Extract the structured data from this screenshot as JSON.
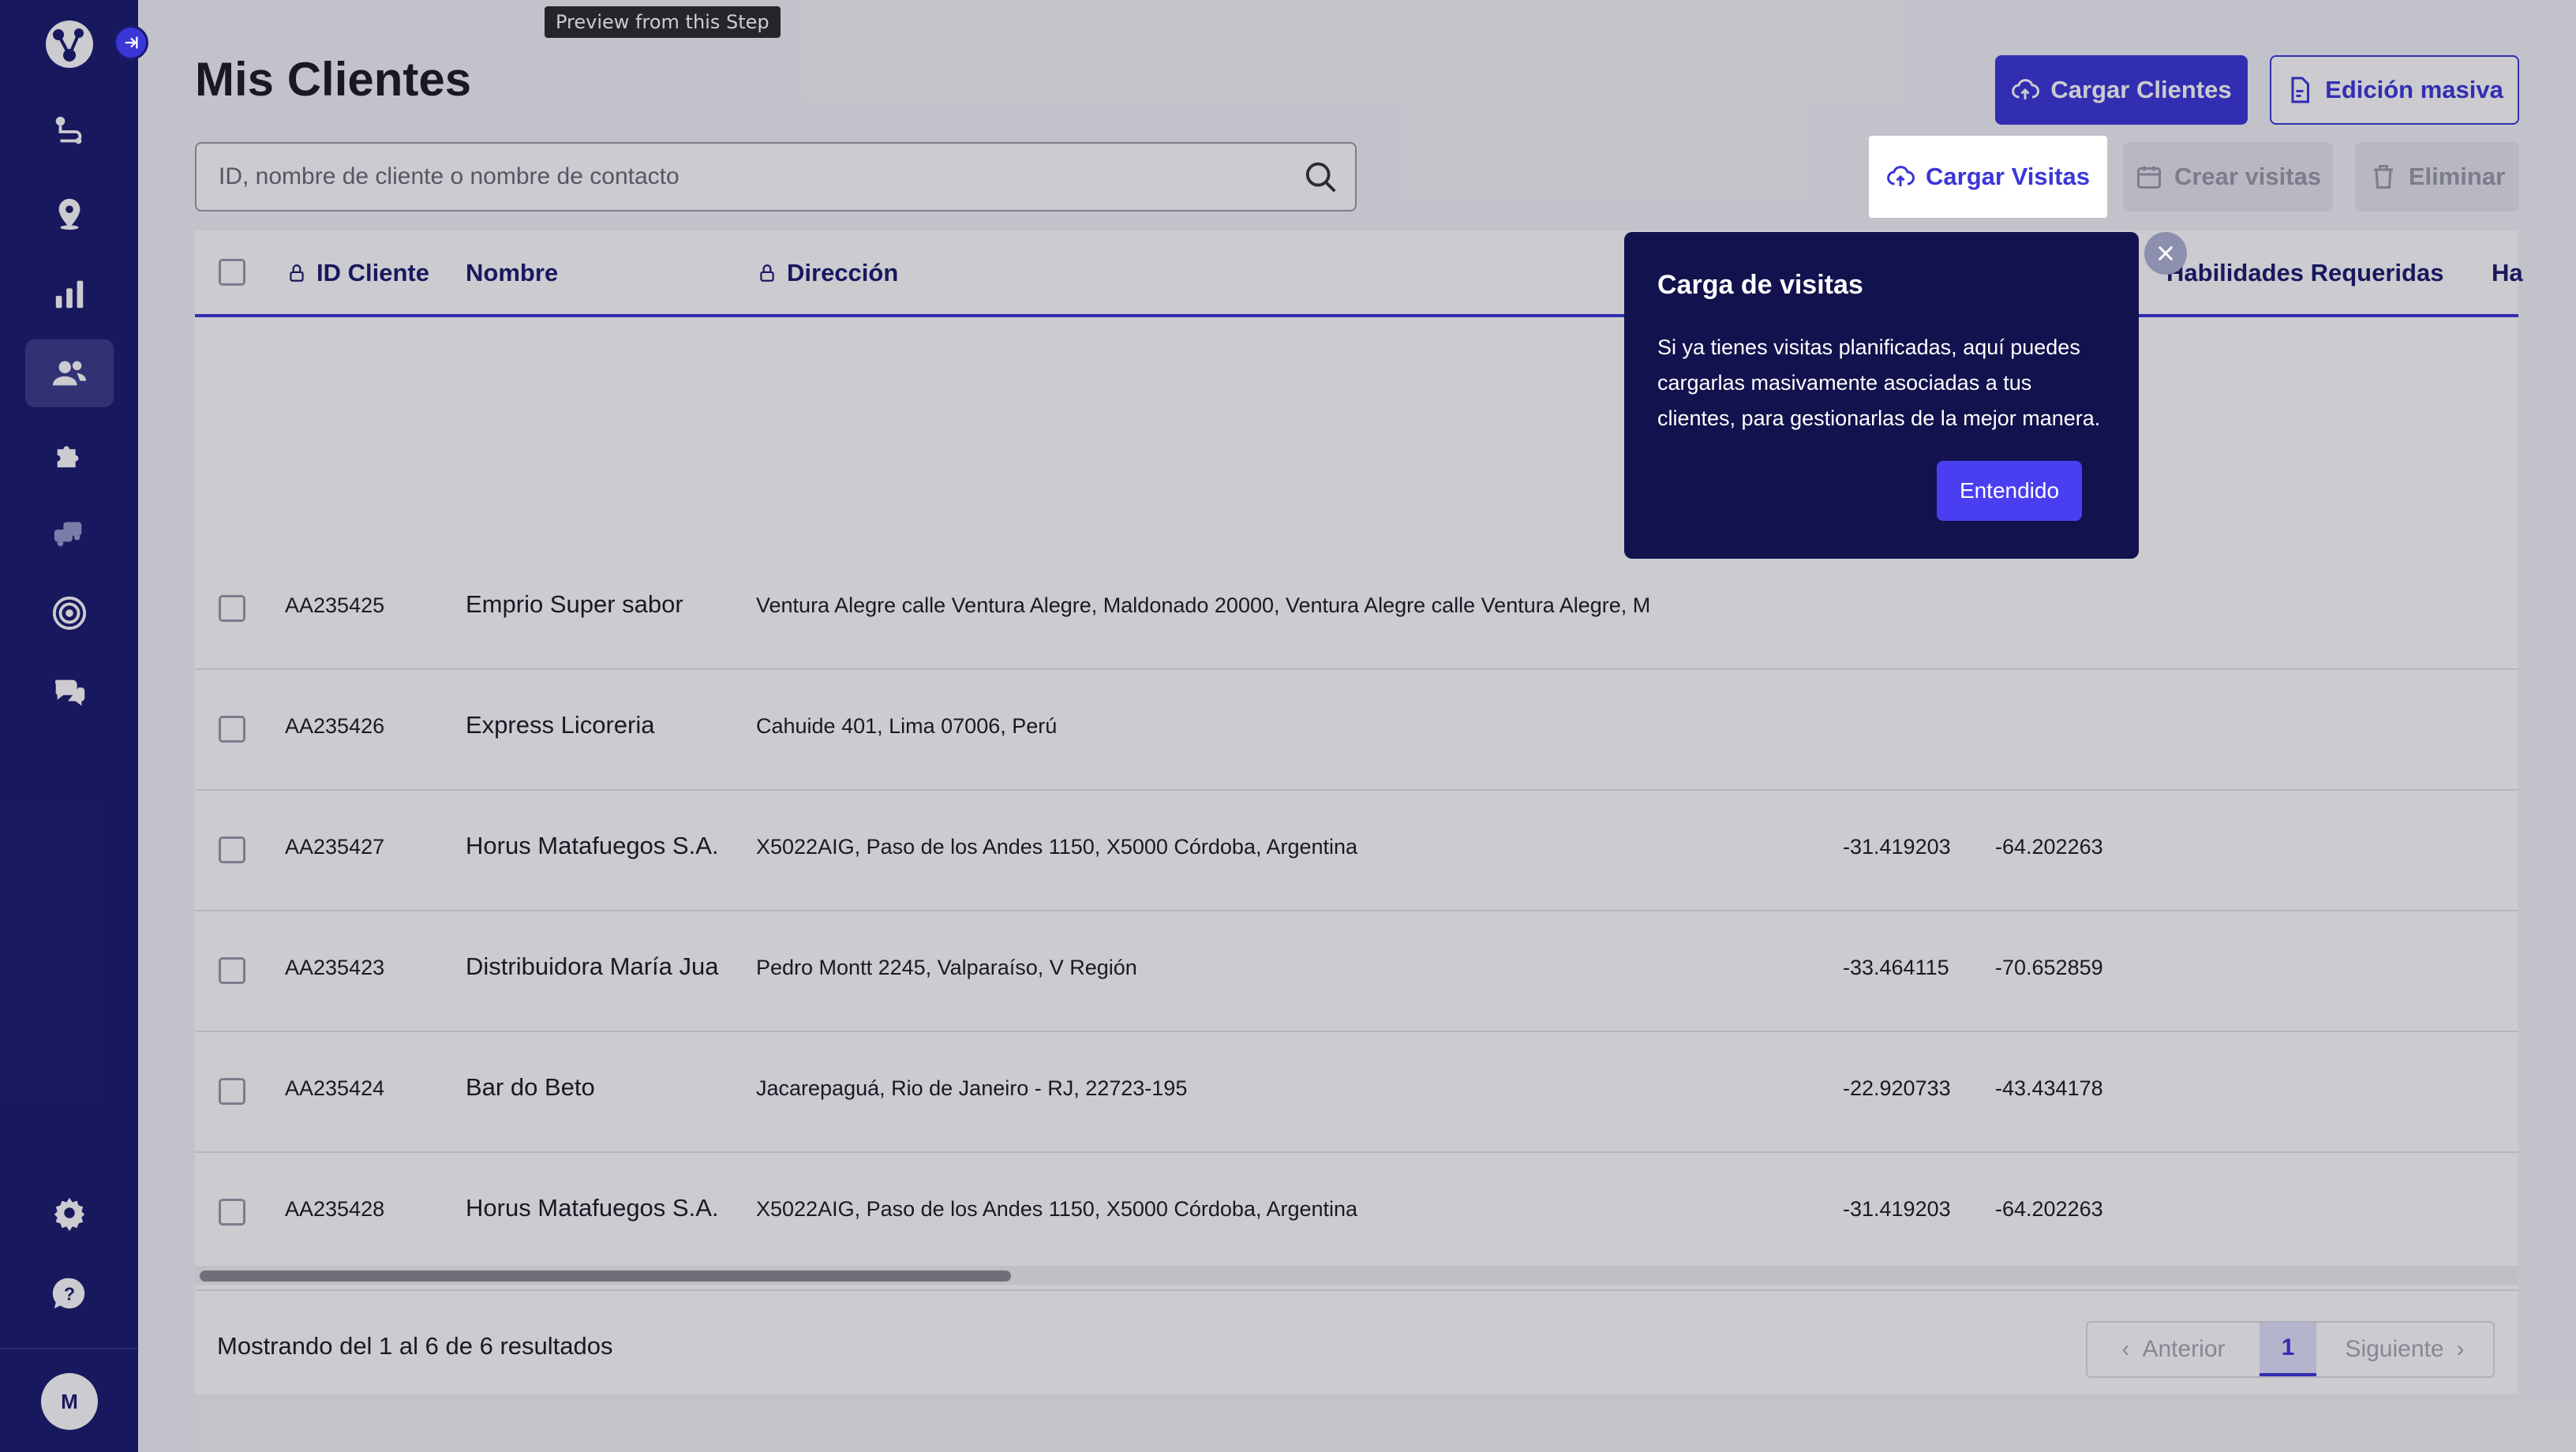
{
  "preview_tooltip": "Preview from this Step",
  "page": {
    "title": "Mis Clientes"
  },
  "actions": {
    "cargar_clientes": "Cargar Clientes",
    "edicion_masiva": "Edición masiva",
    "cargar_visitas": "Cargar Visitas",
    "crear_visitas": "Crear visitas",
    "eliminar": "Eliminar"
  },
  "search": {
    "placeholder": "ID, nombre de cliente o nombre de contacto",
    "value": ""
  },
  "table": {
    "columns": {
      "id": "ID Cliente",
      "nombre": "Nombre",
      "direccion": "Dirección",
      "habilidades": "Habilidades Requeridas",
      "ha": "Ha"
    },
    "rows": [
      {
        "id": "AA235425",
        "nombre": "Emprio Super sabor",
        "direccion": "Ventura Alegre calle Ventura Alegre, Maldonado 20000, Ventura Alegre calle Ventura Alegre, M",
        "lat": "",
        "lng": ""
      },
      {
        "id": "AA235426",
        "nombre": "Express Licoreria",
        "direccion": "Cahuide 401, Lima 07006, Perú",
        "lat": "",
        "lng": ""
      },
      {
        "id": "AA235427",
        "nombre": "Horus Matafuegos S.A.",
        "direccion": "X5022AIG, Paso de los Andes 1150, X5000 Córdoba, Argentina",
        "lat": "-31.419203",
        "lng": "-64.202263"
      },
      {
        "id": "AA235423",
        "nombre": "Distribuidora María Juan",
        "direccion": "Pedro Montt 2245, Valparaíso, V Región",
        "lat": "-33.464115",
        "lng": "-70.652859"
      },
      {
        "id": "AA235424",
        "nombre": "Bar do Beto",
        "direccion": "Jacarepaguá, Rio de Janeiro - RJ, 22723-195",
        "lat": "-22.920733",
        "lng": "-43.434178"
      },
      {
        "id": "AA235428",
        "nombre": "Horus Matafuegos S.A.",
        "direccion": "X5022AIG, Paso de los Andes 1150, X5000 Córdoba, Argentina",
        "lat": "-31.419203",
        "lng": "-64.202263"
      }
    ],
    "results_text": "Mostrando del 1 al 6 de 6 resultados"
  },
  "pagination": {
    "prev": "Anterior",
    "current": "1",
    "next": "Siguiente"
  },
  "popover": {
    "title": "Carga de visitas",
    "body": "Si ya tienes visitas planificadas, aquí puedes cargarlas masivamente asociadas a tus clientes, para gestionarlas de la mejor manera.",
    "button": "Entendido"
  },
  "user": {
    "initial": "M"
  },
  "colors": {
    "sidebar": "#1a1a6e",
    "primary": "#3b36d8",
    "popover": "#12124e"
  }
}
